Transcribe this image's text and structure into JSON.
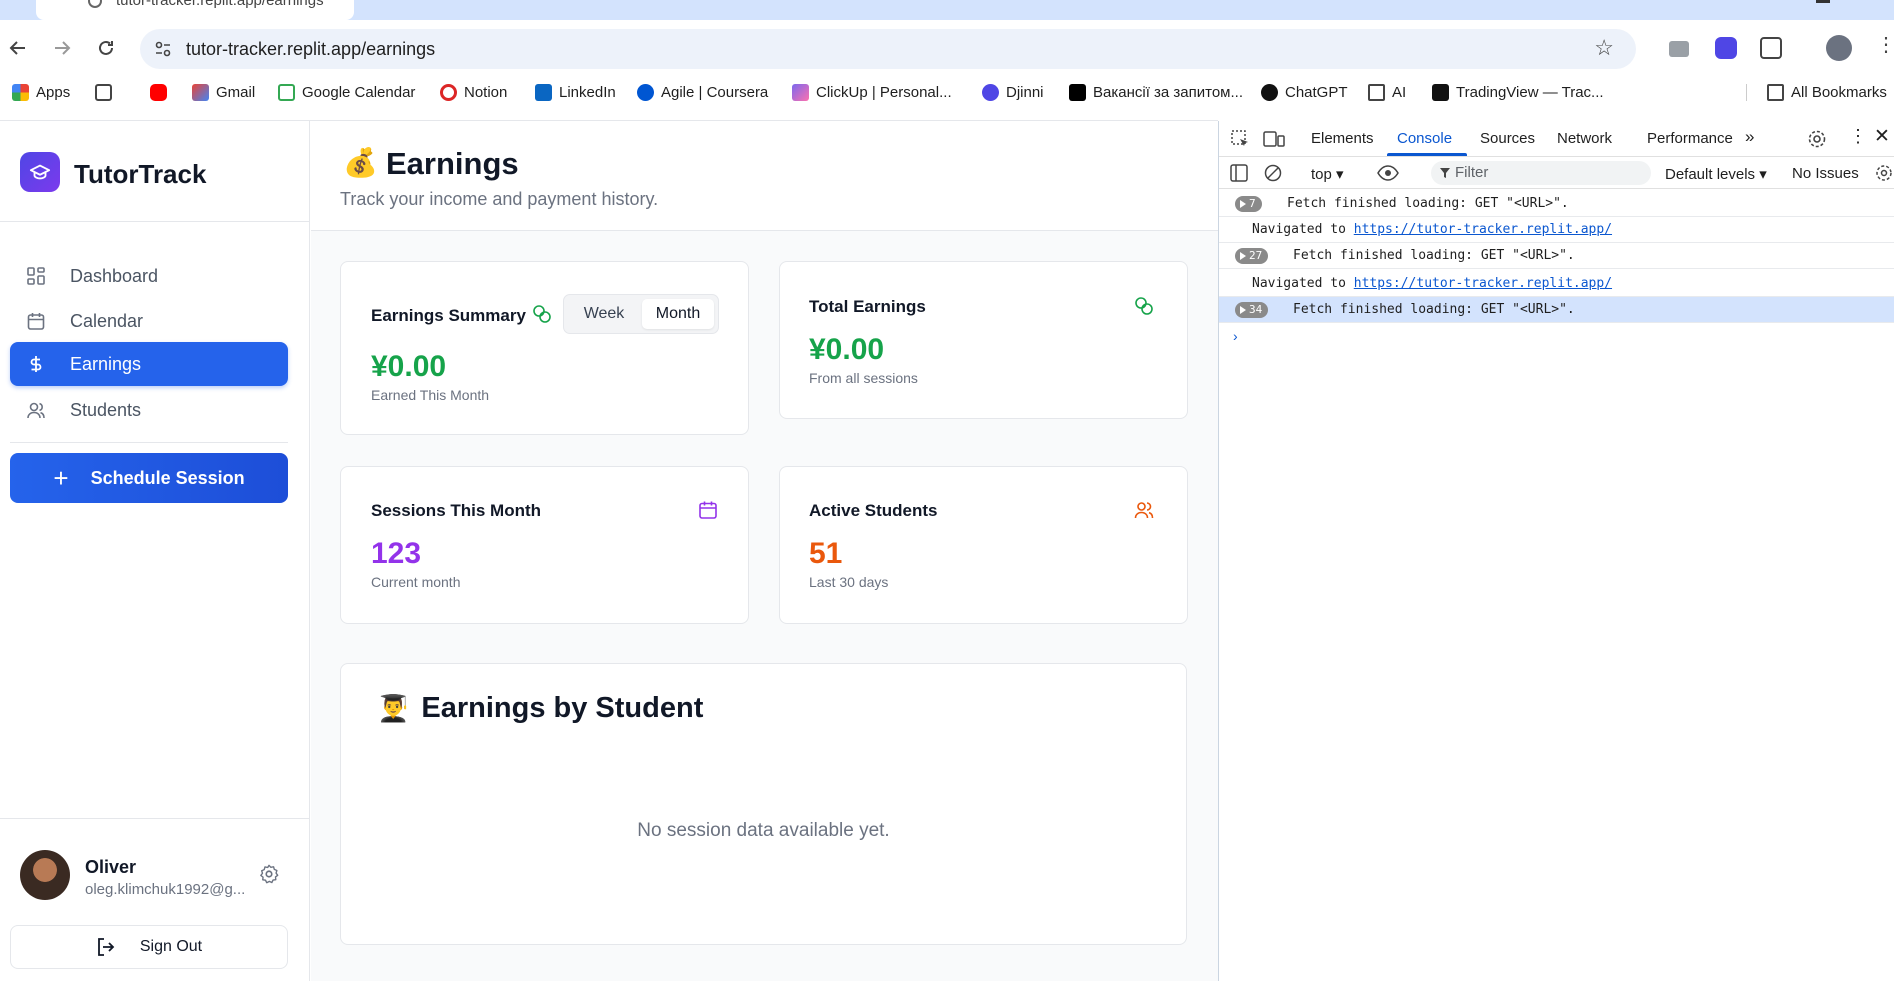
{
  "browser": {
    "tab_title": "tutor-tracker.replit.app/earnings",
    "url": "tutor-tracker.replit.app/earnings",
    "bookmarks": [
      {
        "label": "Apps"
      },
      {
        "label": ""
      },
      {
        "label": "Gmail"
      },
      {
        "label": "Google Calendar"
      },
      {
        "label": "Notion"
      },
      {
        "label": "LinkedIn"
      },
      {
        "label": "Agile | Coursera"
      },
      {
        "label": "ClickUp | Personal..."
      },
      {
        "label": "Djinni"
      },
      {
        "label": "Вакансії за запитом..."
      },
      {
        "label": "ChatGPT"
      },
      {
        "label": "AI"
      },
      {
        "label": "TradingView — Trac..."
      }
    ],
    "all_bookmarks": "All Bookmarks"
  },
  "sidebar": {
    "brand": "TutorTrack",
    "nav": [
      {
        "label": "Dashboard",
        "icon": "grid-icon"
      },
      {
        "label": "Calendar",
        "icon": "calendar-icon"
      },
      {
        "label": "Earnings",
        "icon": "dollar-icon",
        "active": true
      },
      {
        "label": "Students",
        "icon": "users-icon"
      }
    ],
    "schedule_button": "Schedule Session",
    "user": {
      "name": "Oliver",
      "email": "oleg.klimchuk1992@g..."
    },
    "sign_out": "Sign Out"
  },
  "main": {
    "title_emoji": "💰",
    "title": "Earnings",
    "subtitle": "Track your income and payment history.",
    "summary_card": {
      "title": "Earnings Summary",
      "toggle": {
        "week": "Week",
        "month": "Month",
        "selected": "Month"
      },
      "value": "¥0.00",
      "sub": "Earned This Month"
    },
    "total_card": {
      "title": "Total Earnings",
      "value": "¥0.00",
      "sub": "From all sessions"
    },
    "sessions_card": {
      "title": "Sessions This Month",
      "value": "123",
      "sub": "Current month"
    },
    "students_card": {
      "title": "Active Students",
      "value": "51",
      "sub": "Last 30 days"
    },
    "by_student": {
      "emoji": "👨‍🎓",
      "title": "Earnings by Student",
      "empty": "No session data available yet."
    }
  },
  "colors": {
    "primary": "#2563eb",
    "green": "#16a34a",
    "purple": "#9333ea",
    "orange": "#ea580c"
  },
  "devtools": {
    "tabs": [
      "Elements",
      "Console",
      "Sources",
      "Network",
      "Performance"
    ],
    "active_tab": "Console",
    "context": "top ▾",
    "filter_placeholder": "Filter",
    "levels": "Default levels ▾",
    "issues": "No Issues",
    "logs": [
      {
        "count": "7",
        "text": "Fetch finished loading: GET \"<URL>\"."
      },
      {
        "nav_prefix": "Navigated to ",
        "link": "https://tutor-tracker.replit.app/"
      },
      {
        "count": "27",
        "text": "Fetch finished loading: GET \"<URL>\"."
      },
      {
        "nav_prefix": "Navigated to ",
        "link": "https://tutor-tracker.replit.app/"
      },
      {
        "count": "34",
        "text": "Fetch finished loading: GET \"<URL>\"."
      }
    ],
    "prompt": "›"
  }
}
